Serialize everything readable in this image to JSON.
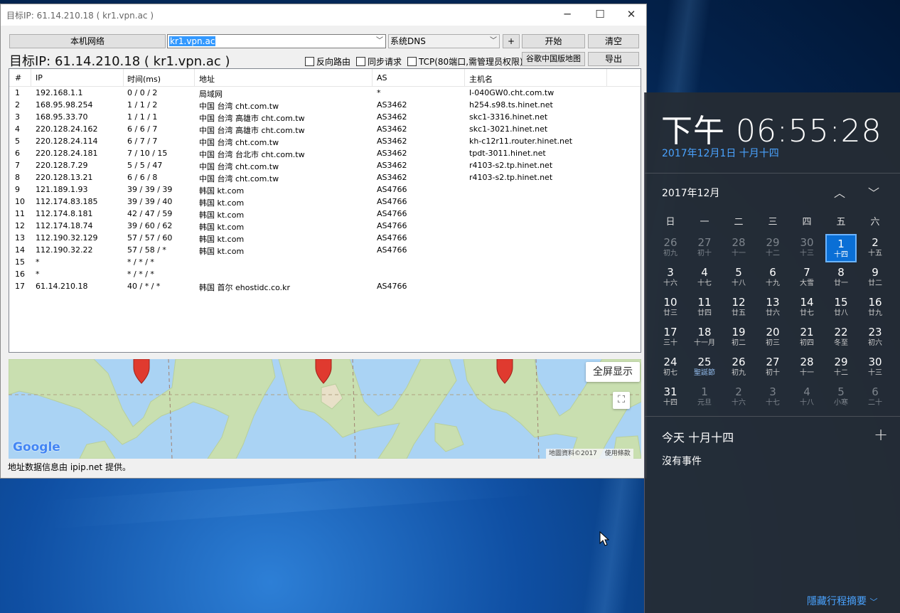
{
  "window": {
    "title": "目标IP: 61.14.210.18 ( kr1.vpn.ac )",
    "controls": {
      "minimize": "─",
      "maximize": "☐",
      "close": "✕"
    }
  },
  "toolbar": {
    "local_network": "本机网络",
    "host_value": "kr1.vpn.ac",
    "dns_value": "系统DNS",
    "plus": "+",
    "start": "开始",
    "clear": "清空",
    "google_map": "谷歌中国版地图",
    "export": "导出",
    "reverse_route": "反向路由",
    "sync_request": "同步请求",
    "tcp": "TCP(80端口,需管理员权限)"
  },
  "target_title": "目标IP: 61.14.210.18 ( kr1.vpn.ac )",
  "table": {
    "headers": [
      "#",
      "IP",
      "时间(ms)",
      "地址",
      "AS",
      "主机名"
    ],
    "rows": [
      [
        "1",
        "192.168.1.1",
        "0 / 0 / 2",
        "局域网",
        "*",
        "I-040GW0.cht.com.tw"
      ],
      [
        "2",
        "168.95.98.254",
        "1 / 1 / 2",
        "中国 台湾 cht.com.tw",
        "AS3462",
        "h254.s98.ts.hinet.net"
      ],
      [
        "3",
        "168.95.33.70",
        "1 / 1 / 1",
        "中国 台湾 高雄市 cht.com.tw",
        "AS3462",
        "skc1-3316.hinet.net"
      ],
      [
        "4",
        "220.128.24.162",
        "6 / 6 / 7",
        "中国 台湾 高雄市 cht.com.tw",
        "AS3462",
        "skc1-3021.hinet.net"
      ],
      [
        "5",
        "220.128.24.114",
        "6 / 7 / 7",
        "中国 台湾 cht.com.tw",
        "AS3462",
        "kh-c12r11.router.hinet.net"
      ],
      [
        "6",
        "220.128.24.181",
        "7 / 10 / 15",
        "中国 台湾 台北市 cht.com.tw",
        "AS3462",
        "tpdt-3011.hinet.net"
      ],
      [
        "7",
        "220.128.7.29",
        "5 / 5 / 47",
        "中国 台湾 cht.com.tw",
        "AS3462",
        "r4103-s2.tp.hinet.net"
      ],
      [
        "8",
        "220.128.13.21",
        "6 / 6 / 8",
        "中国 台湾 cht.com.tw",
        "AS3462",
        "r4103-s2.tp.hinet.net"
      ],
      [
        "9",
        "121.189.1.93",
        "39 / 39 / 39",
        "韩国 kt.com",
        "AS4766",
        ""
      ],
      [
        "10",
        "112.174.83.185",
        "39 / 39 / 40",
        "韩国 kt.com",
        "AS4766",
        ""
      ],
      [
        "11",
        "112.174.8.181",
        "42 / 47 / 59",
        "韩国 kt.com",
        "AS4766",
        ""
      ],
      [
        "12",
        "112.174.18.74",
        "39 / 60 / 62",
        "韩国 kt.com",
        "AS4766",
        ""
      ],
      [
        "13",
        "112.190.32.129",
        "57 / 57 / 60",
        "韩国 kt.com",
        "AS4766",
        ""
      ],
      [
        "14",
        "112.190.32.22",
        "57 / 58 / *",
        "韩国 kt.com",
        "AS4766",
        ""
      ],
      [
        "15",
        "*",
        "* / * / *",
        "",
        "",
        ""
      ],
      [
        "16",
        "*",
        "* / * / *",
        "",
        "",
        ""
      ],
      [
        "17",
        "61.14.210.18",
        "40 / * / *",
        "韩国 首尔 ehostidc.co.kr",
        "AS4766",
        ""
      ]
    ]
  },
  "map": {
    "fullscreen_label": "全屏显示",
    "google_logo": "Google",
    "copyright": "地圖資料©2017",
    "terms": "使用條款"
  },
  "status_text": "地址数据信息由 ipip.net 提供。",
  "calendar": {
    "time": "下午 06:55:28",
    "lunar_date": "2017年12月1日 十月十四",
    "month_label": "2017年12月",
    "weekdays": [
      "日",
      "一",
      "二",
      "三",
      "四",
      "五",
      "六"
    ],
    "days": [
      {
        "n": "26",
        "l": "初九",
        "dim": true
      },
      {
        "n": "27",
        "l": "初十",
        "dim": true
      },
      {
        "n": "28",
        "l": "十一",
        "dim": true
      },
      {
        "n": "29",
        "l": "十二",
        "dim": true
      },
      {
        "n": "30",
        "l": "十三",
        "dim": true
      },
      {
        "n": "1",
        "l": "十四",
        "today": true
      },
      {
        "n": "2",
        "l": "十五"
      },
      {
        "n": "3",
        "l": "十六"
      },
      {
        "n": "4",
        "l": "十七"
      },
      {
        "n": "5",
        "l": "十八"
      },
      {
        "n": "6",
        "l": "十九"
      },
      {
        "n": "7",
        "l": "大雪"
      },
      {
        "n": "8",
        "l": "廿一"
      },
      {
        "n": "9",
        "l": "廿二"
      },
      {
        "n": "10",
        "l": "廿三"
      },
      {
        "n": "11",
        "l": "廿四"
      },
      {
        "n": "12",
        "l": "廿五"
      },
      {
        "n": "13",
        "l": "廿六"
      },
      {
        "n": "14",
        "l": "廿七"
      },
      {
        "n": "15",
        "l": "廿八"
      },
      {
        "n": "16",
        "l": "廿九"
      },
      {
        "n": "17",
        "l": "三十"
      },
      {
        "n": "18",
        "l": "十一月"
      },
      {
        "n": "19",
        "l": "初二"
      },
      {
        "n": "20",
        "l": "初三"
      },
      {
        "n": "21",
        "l": "初四"
      },
      {
        "n": "22",
        "l": "冬至"
      },
      {
        "n": "23",
        "l": "初六"
      },
      {
        "n": "24",
        "l": "初七"
      },
      {
        "n": "25",
        "l": "聖誕節",
        "fest": true
      },
      {
        "n": "26",
        "l": "初九"
      },
      {
        "n": "27",
        "l": "初十"
      },
      {
        "n": "28",
        "l": "十一"
      },
      {
        "n": "29",
        "l": "十二"
      },
      {
        "n": "30",
        "l": "十三"
      },
      {
        "n": "31",
        "l": "十四"
      },
      {
        "n": "1",
        "l": "元旦",
        "dim": true
      },
      {
        "n": "2",
        "l": "十六",
        "dim": true
      },
      {
        "n": "3",
        "l": "十七",
        "dim": true
      },
      {
        "n": "4",
        "l": "十八",
        "dim": true
      },
      {
        "n": "5",
        "l": "小寒",
        "dim": true
      },
      {
        "n": "6",
        "l": "二十",
        "dim": true
      }
    ],
    "agenda_title": "今天 十月十四",
    "add": "+",
    "no_events": "沒有事件",
    "hide_agenda": "隱藏行程摘要"
  }
}
